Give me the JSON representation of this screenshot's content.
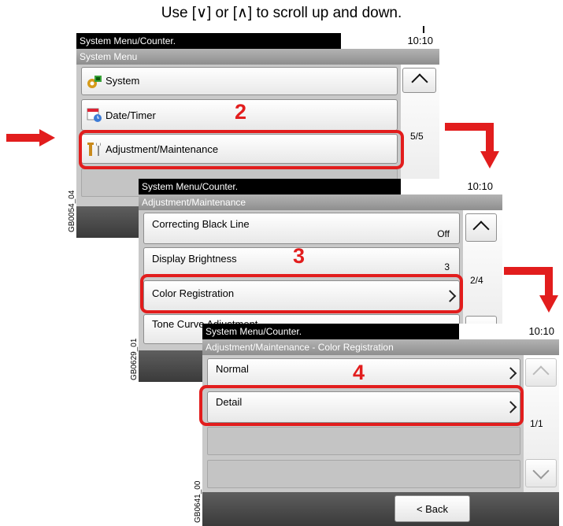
{
  "caption": "Use [∨] or [∧] to scroll up and down.",
  "screen1": {
    "title": "System Menu/Counter.",
    "time": "10:10",
    "subtitle": "System Menu",
    "items": [
      {
        "label": "System",
        "icon": "system-icon"
      },
      {
        "label": "Date/Timer",
        "icon": "date-timer-icon"
      },
      {
        "label": "Adjustment/Maintenance",
        "icon": "adjustment-maintenance-icon"
      }
    ],
    "page": "5/5",
    "code": "GB0054_04",
    "step": "2"
  },
  "screen2": {
    "title": "System Menu/Counter.",
    "time": "10:10",
    "subtitle": "Adjustment/Maintenance",
    "items": [
      {
        "label": "Correcting Black Line",
        "value": "Off"
      },
      {
        "label": "Display Brightness",
        "value": "3"
      },
      {
        "label": "Color Registration"
      },
      {
        "label": "Tone Curve Adjustment"
      }
    ],
    "page": "2/4",
    "code": "GB0629_01",
    "step": "3"
  },
  "screen3": {
    "title": "System Menu/Counter.",
    "time": "10:10",
    "subtitle": "Adjustment/Maintenance - Color Registration",
    "items": [
      {
        "label": "Normal"
      },
      {
        "label": "Detail"
      }
    ],
    "page": "1/1",
    "back": "< Back",
    "code": "GB0641_00",
    "step": "4"
  },
  "colors": {
    "highlight": "#e21d1d",
    "titlebar": "#000000",
    "subbar": "#9e9e9e"
  }
}
